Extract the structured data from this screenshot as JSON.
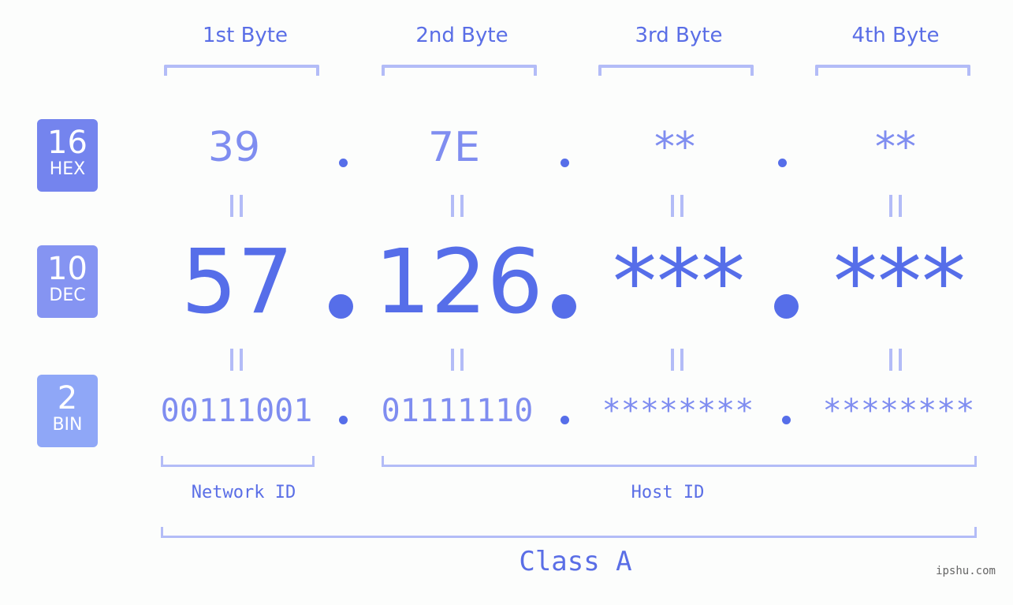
{
  "bytes": {
    "headers": [
      "1st Byte",
      "2nd Byte",
      "3rd Byte",
      "4th Byte"
    ]
  },
  "badges": {
    "hex": {
      "number": "16",
      "label": "HEX",
      "color": "#7484ee"
    },
    "dec": {
      "number": "10",
      "label": "DEC",
      "color": "#8594f2"
    },
    "bin": {
      "number": "2",
      "label": "BIN",
      "color": "#8fa7f7"
    }
  },
  "hex_values": [
    "39",
    "7E",
    "**",
    "**"
  ],
  "dec_values": [
    "57",
    "126",
    "***",
    "***"
  ],
  "bin_values": [
    "00111001",
    "01111110",
    "********",
    "********"
  ],
  "separator": ".",
  "equals_sign": "=",
  "segments": {
    "network": "Network ID",
    "host": "Host ID"
  },
  "ip_class": "Class A",
  "watermark": "ipshu.com",
  "colors": {
    "accent": "#566ee9",
    "light_value": "#7f8df0",
    "bracket": "#b3bcf7",
    "text_label": "#5a6ee6",
    "watermark": "#666666",
    "background": "#fcfdfc"
  }
}
